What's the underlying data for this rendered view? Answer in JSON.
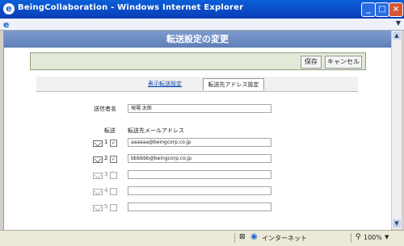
{
  "window": {
    "title": "BeingCollaboration - Windows Internet Explorer"
  },
  "page": {
    "header_title": "転送設定の変更"
  },
  "toolbar": {
    "save_label": "保存",
    "cancel_label": "キャンセル"
  },
  "tabs": [
    {
      "label": "表示転送設定",
      "active": false
    },
    {
      "label": "転送先アドレス設定",
      "active": true
    }
  ],
  "form": {
    "sender_label": "送信者名",
    "sender_value": "現場 太郎",
    "forward_label": "転送",
    "address_header": "転送先メールアドレス",
    "rows": [
      {
        "num": "1",
        "checked": true,
        "email": "aaaaaa@beingcorp.co.jp"
      },
      {
        "num": "2",
        "checked": true,
        "email": "bbbbbb@beingcorp.co.jp"
      },
      {
        "num": "3",
        "checked": false,
        "email": ""
      },
      {
        "num": "4",
        "checked": false,
        "email": ""
      },
      {
        "num": "5",
        "checked": false,
        "email": ""
      }
    ]
  },
  "statusbar": {
    "zone": "インターネット",
    "zoom": "100%"
  }
}
